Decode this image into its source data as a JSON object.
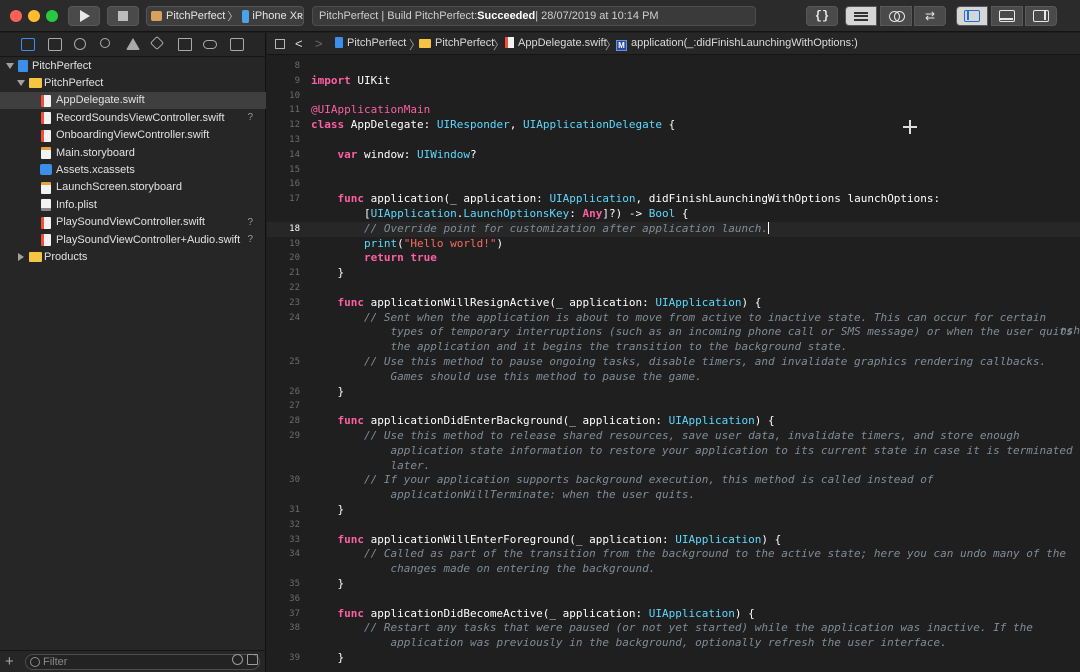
{
  "toolbar": {
    "scheme_project": "PitchPerfect",
    "scheme_device": "iPhone Xʀ",
    "activity_prefix": "PitchPerfect | Build PitchPerfect: ",
    "activity_status": "Succeeded",
    "activity_time": " | 28/07/2019 at 10:14 PM",
    "library_label": "{}",
    "version_label": "⇄"
  },
  "navigator": {
    "tree": [
      {
        "label": "PitchPerfect"
      },
      {
        "label": "PitchPerfect"
      },
      {
        "label": "AppDelegate.swift"
      },
      {
        "label": "RecordSoundsViewController.swift",
        "status": "?"
      },
      {
        "label": "OnboardingViewController.swift"
      },
      {
        "label": "Main.storyboard"
      },
      {
        "label": "Assets.xcassets"
      },
      {
        "label": "LaunchScreen.storyboard"
      },
      {
        "label": "Info.plist"
      },
      {
        "label": "PlaySoundViewController.swift",
        "status": "?"
      },
      {
        "label": "PlaySoundViewController+Audio.swift",
        "status": "?"
      },
      {
        "label": "Products"
      }
    ],
    "filter_placeholder": "Filter",
    "add_label": "+"
  },
  "jumpbar": {
    "crumbs": [
      "PitchPerfect",
      "PitchPerfect",
      "AppDelegate.swift",
      "application(_:didFinishLaunchingWithOptions:)"
    ],
    "method_badge": "M",
    "back": "<",
    "forward": ">",
    "separator": "〉"
  },
  "editor": {
    "line_numbers": [
      "8",
      "9",
      "10",
      "11",
      "12",
      "13",
      "14",
      "15",
      "16",
      "17",
      "",
      "18",
      "19",
      "20",
      "21",
      "22",
      "23",
      "24",
      "",
      "",
      "25",
      "",
      "26",
      "27",
      "28",
      "29",
      "",
      "",
      "30",
      "",
      "31",
      "32",
      "33",
      "34",
      "",
      "35",
      "36",
      "37",
      "38",
      "",
      "39"
    ],
    "current_line": "18",
    "edge_text": "nsh"
  }
}
